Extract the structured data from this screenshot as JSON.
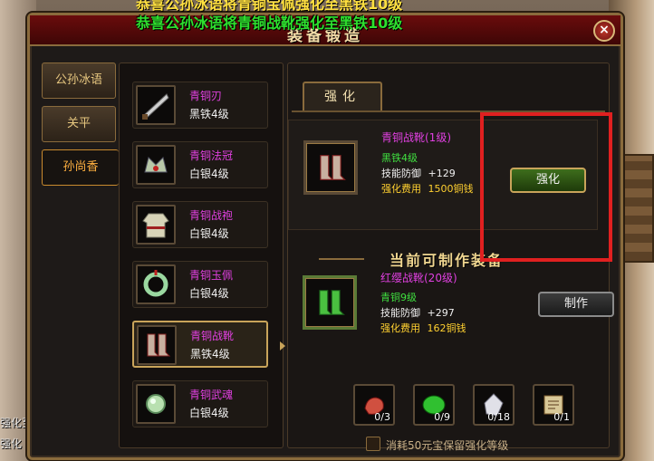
{
  "announcement": {
    "top_line": "恭喜公孙冰语将青铜宝佩强化至黑铁10级",
    "line": "恭喜公孙冰语将青铜战靴强化至黑铁10级"
  },
  "side_chat": [
    "强化至黑",
    "强化 至黑"
  ],
  "window": {
    "title": "装备锻造",
    "close": "×"
  },
  "characters": [
    {
      "name": "公孙冰语",
      "active": false
    },
    {
      "name": "关平",
      "active": false
    },
    {
      "name": "孙尚香",
      "active": true
    }
  ],
  "items": [
    {
      "name": "青铜刃",
      "grade": "黑铁4级",
      "icon": "blade-icon",
      "active": false
    },
    {
      "name": "青铜法冠",
      "grade": "白银4级",
      "icon": "crown-icon",
      "active": false
    },
    {
      "name": "青铜战袍",
      "grade": "白银4级",
      "icon": "robe-icon",
      "active": false
    },
    {
      "name": "青铜玉佩",
      "grade": "白银4级",
      "icon": "jade-pendant-icon",
      "active": false
    },
    {
      "name": "青铜战靴",
      "grade": "黑铁4级",
      "icon": "boots-icon",
      "active": true
    },
    {
      "name": "青铜武魂",
      "grade": "白银4级",
      "icon": "orb-icon",
      "active": false
    }
  ],
  "strengthen_tab": "强化",
  "current": {
    "name": "青铜战靴(1级)",
    "grade": "黑铁4级",
    "stat_label": "技能防御",
    "stat_value": "+129",
    "cost_label": "强化费用",
    "cost_value": "1500铜钱",
    "button": "强化"
  },
  "section_title": "当前可制作装备",
  "craftable": {
    "name": "红缨战靴(20级)",
    "grade": "青铜9级",
    "stat_label": "技能防御",
    "stat_value": "+297",
    "cost_label": "强化费用",
    "cost_value": "162铜钱",
    "button": "制作"
  },
  "materials": [
    {
      "icon": "red-ore-icon",
      "count": "0/3"
    },
    {
      "icon": "green-jade-icon",
      "count": "0/9"
    },
    {
      "icon": "crystal-icon",
      "count": "0/18"
    },
    {
      "icon": "scroll-icon",
      "count": "0/1"
    }
  ],
  "option_label": "消耗50元宝保留强化等级",
  "colors": {
    "highlight": "#e02020",
    "purple_name": "#e040e0",
    "green": "#40e040",
    "gold": "#ffd030"
  }
}
